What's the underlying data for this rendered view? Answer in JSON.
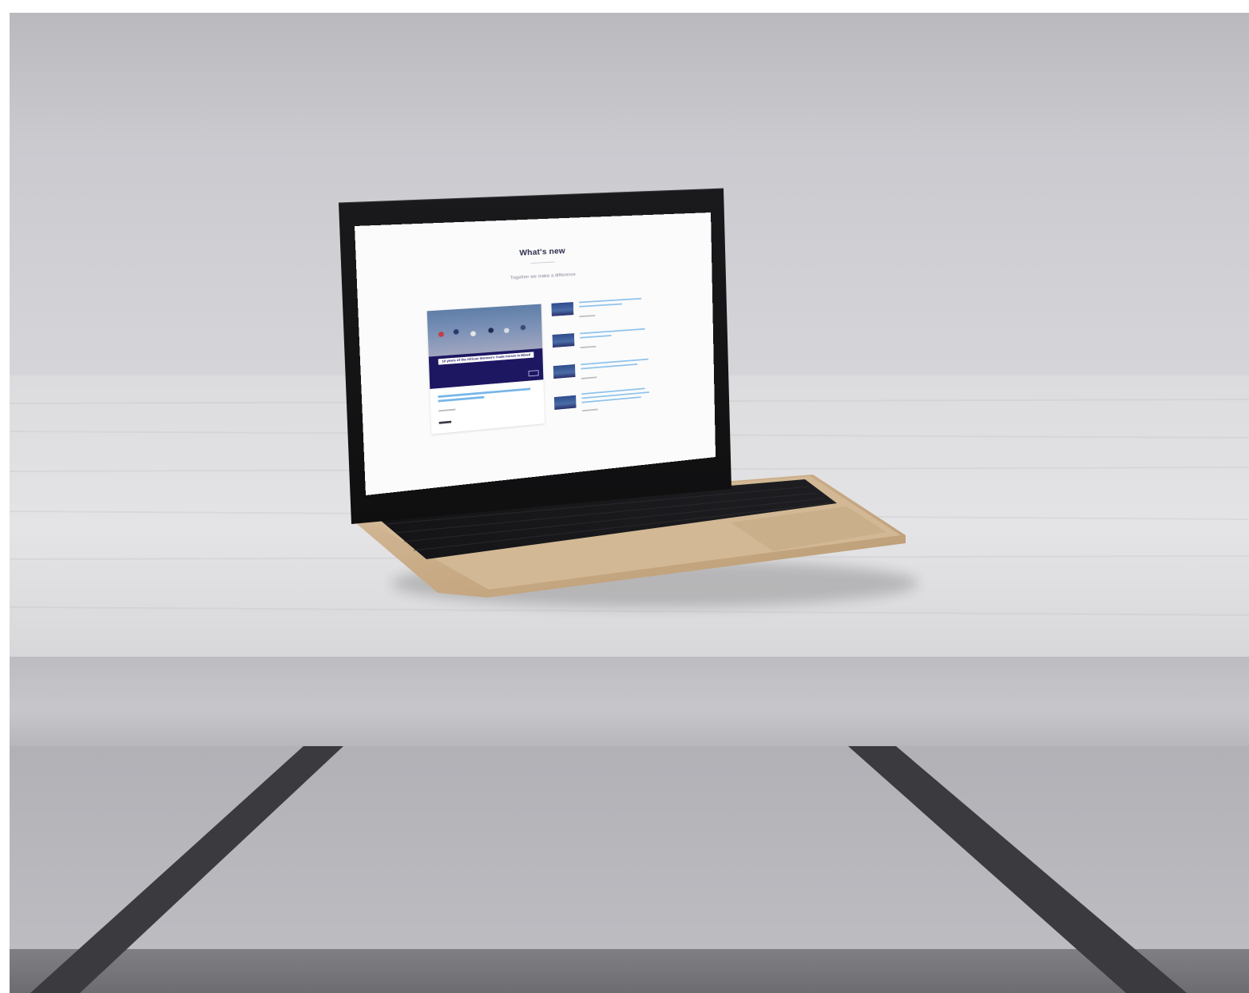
{
  "screen": {
    "title": "What's new",
    "subtitle": "Together we make a difference",
    "feature": {
      "banner_text": "10 years of the African Women's Trade Forum in Mixed Regions"
    }
  }
}
